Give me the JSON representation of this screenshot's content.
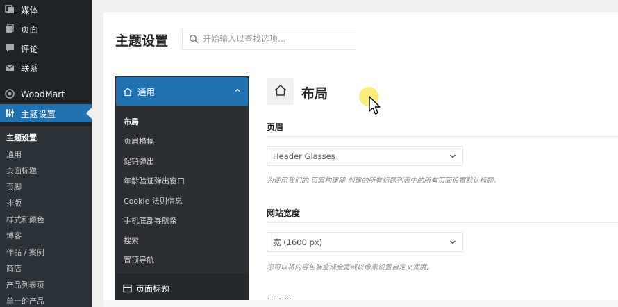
{
  "wp_sidebar": {
    "menu": [
      {
        "label": "媒体",
        "icon": "media-icon"
      },
      {
        "label": "页面",
        "icon": "page-icon"
      },
      {
        "label": "评论",
        "icon": "comment-icon"
      },
      {
        "label": "联系",
        "icon": "mail-icon"
      },
      {
        "label": "WoodMart",
        "icon": "woodmart-icon"
      },
      {
        "label": "主题设置",
        "icon": "settings-sliders-icon",
        "active": true
      }
    ],
    "submenu": [
      "主题设置",
      "通用",
      "页面标题",
      "页脚",
      "排版",
      "样式和颜色",
      "博客",
      "作品 / 案例",
      "商店",
      "产品列表页",
      "单一的产品"
    ]
  },
  "header": {
    "title": "主题设置",
    "search_placeholder": "开始输入以查找选项..."
  },
  "options_nav": {
    "group_label": "通用",
    "items": [
      "布局",
      "页眉横幅",
      "促销弹出",
      "年龄验证弹出窗口",
      "Cookie 法则信息",
      "手机底部导航条",
      "搜索",
      "置顶导航"
    ],
    "footer_item": "页面标题"
  },
  "section": {
    "title": "布局",
    "fields": [
      {
        "label": "页眉",
        "value": "Header Glasses",
        "hint": "为使用我们的 页眉构建器 创建的所有标题列表中的所有页面设置默认标题。"
      },
      {
        "label": "网站宽度",
        "value": "宽 (1600 px)",
        "hint": "您可以将内容包装盒成全宽或以像素设置自定义宽度。"
      }
    ],
    "next_label": "侧边栏"
  },
  "colors": {
    "sidebar_bg": "#1d2327",
    "accent": "#2271b1",
    "panel_nav_bg": "#2b2f33"
  }
}
